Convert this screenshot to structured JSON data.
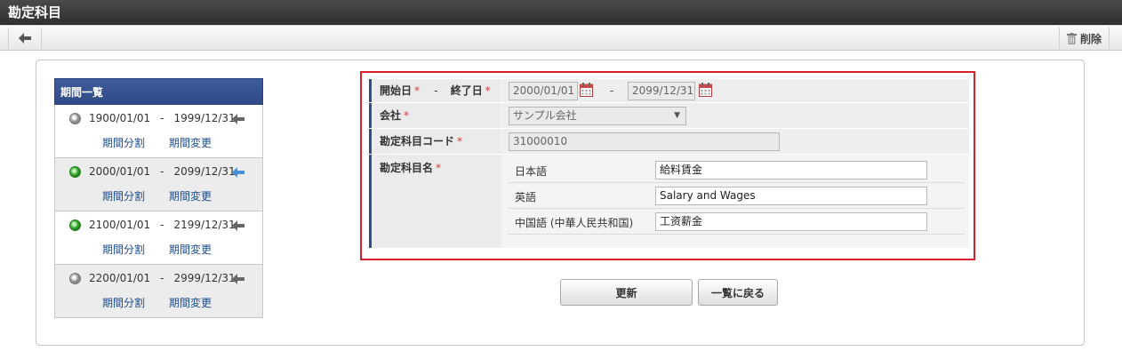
{
  "title": "勘定科目",
  "toolbar": {
    "delete_label": "削除",
    "back_icon": "arrow-left-icon",
    "delete_icon": "trash-icon"
  },
  "period_list": {
    "header": "期間一覧",
    "items": [
      {
        "start": "1900/01/01",
        "dash": "-",
        "end": "1999/12/31",
        "selected": false,
        "arrow_color": "#666666",
        "split_label": "期間分割",
        "change_label": "期間変更"
      },
      {
        "start": "2000/01/01",
        "dash": "-",
        "end": "2099/12/31",
        "selected": true,
        "arrow_color": "#4a90d9",
        "split_label": "期間分割",
        "change_label": "期間変更"
      },
      {
        "start": "2100/01/01",
        "dash": "-",
        "end": "2199/12/31",
        "selected": true,
        "arrow_color": "#666666",
        "split_label": "期間分割",
        "change_label": "期間変更"
      },
      {
        "start": "2200/01/01",
        "dash": "-",
        "end": "2999/12/31",
        "selected": false,
        "arrow_color": "#666666",
        "split_label": "期間分割",
        "change_label": "期間変更"
      }
    ]
  },
  "form": {
    "start_label": "開始日",
    "range_dash": "-",
    "end_label": "終了日",
    "required_mark": "*",
    "start_date": "2000/01/01",
    "end_date": "2099/12/31",
    "company_label": "会社",
    "company_value": "サンプル会社",
    "code_label": "勘定科目コード",
    "code_value": "31000010",
    "name_label": "勘定科目名",
    "names": [
      {
        "lang": "日本語",
        "value": "給料賃金"
      },
      {
        "lang": "英語",
        "value": "Salary and Wages"
      },
      {
        "lang": "中国語 (中華人民共和国)",
        "value": "工资薪金"
      }
    ]
  },
  "buttons": {
    "update": "更新",
    "back_to_list": "一覧に戻る"
  },
  "colors": {
    "accent": "#2f4a86",
    "highlight_border": "#d6202a",
    "required": "#d23b3b",
    "link": "#1a4d8f"
  }
}
